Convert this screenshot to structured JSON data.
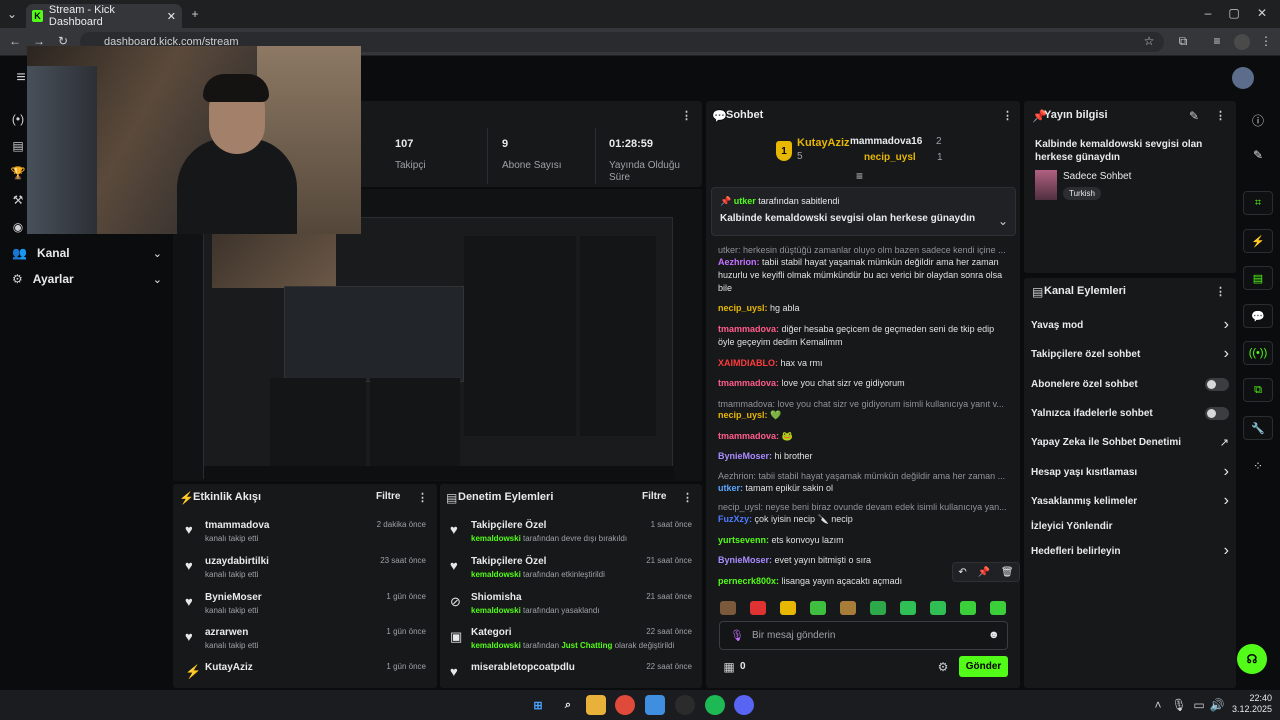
{
  "browser": {
    "tab_title": "Stream - Kick Dashboard",
    "url": "dashboard.kick.com/stream",
    "new_tab": "+"
  },
  "nav": {
    "channel": "Kanal",
    "settings": "Ayarlar"
  },
  "stats": [
    {
      "value": "107",
      "label": "Takipçi"
    },
    {
      "value": "9",
      "label": "Abone Sayısı"
    },
    {
      "value": "01:28:59",
      "label": "Yayında Olduğu Süre"
    }
  ],
  "chat": {
    "title": "Sohbet",
    "leaderboard": {
      "first": {
        "rank": "1",
        "name": "KutayAziz",
        "count": "5"
      },
      "others": [
        {
          "name": "mammadova16",
          "count": "2"
        },
        {
          "name": "necip_uysl",
          "count": "1"
        }
      ]
    },
    "pinned": {
      "by_user": "utker",
      "by_text": "tarafından sabitlendi",
      "message": "Kalbinde kemaldowski sevgisi olan herkese günaydın"
    },
    "messages": [
      {
        "reply": "utker: herkesin düştüğü zamanlar oluyo olm bazen sadece kendi içine ...",
        "user": "Aezhrion",
        "color": "#c471ff",
        "text": "tabii stabil hayat yaşamak mümkün değildir ama her zaman huzurlu ve keyifli olmak mümkündür bu acı verici bir olaydan sonra olsa bile"
      },
      {
        "user": "necip_uysl",
        "color": "#e8b700",
        "text": "hg abla"
      },
      {
        "user": "tmammadova",
        "color": "#ff5c8a",
        "text": "diğer hesaba geçicem de geçmeden seni de tkip edip öyle geçeyim dedim Kemalimm"
      },
      {
        "user": "XAIMDIABLO",
        "color": "#ff3b3b",
        "text": "hax va rmı"
      },
      {
        "user": "tmammadova",
        "color": "#ff5c8a",
        "text": "love you chat sizr ve gidiyorum"
      },
      {
        "reply": "tmammadova: love you chat sizr ve gidiyorum isimli kullanıcıya yanıt v...",
        "user": "necip_uysl",
        "color": "#e8b700",
        "text": "💚"
      },
      {
        "user": "tmammadova",
        "color": "#ff5c8a",
        "text": "🐸"
      },
      {
        "user": "BynieMoser",
        "color": "#a98cff",
        "text": "hi brother"
      },
      {
        "reply": "Aezhrion: tabii stabil hayat yaşamak mümkün değildir ama her zaman ...",
        "user": "utker",
        "color": "#5aa8ff",
        "text": "tamam epikür sakin ol"
      },
      {
        "reply": "necip_uysl: neyse beni biraz ovunde devam edek isimli kullanıcıya yan...",
        "user": "FuzXzy",
        "color": "#4d7cff",
        "text": "çok iyisin necip 🔪 necip"
      },
      {
        "user": "yurtsevenn",
        "color": "#53fc18",
        "text": "ets konvoyu lazım"
      },
      {
        "user": "BynieMoser",
        "color": "#a98cff",
        "text": "evet yayın bitmişti o sıra"
      },
      {
        "user": "pernecrk800x",
        "color": "#53fc18",
        "text": "lisanga yayın açacaktı açmadı"
      }
    ],
    "input_placeholder": "Bir mesaj gönderin",
    "points": "0",
    "send": "Gönder"
  },
  "info": {
    "title": "Yayın bilgisi",
    "stream_title": "Kalbinde kemaldowski sevgisi olan herkese günaydın",
    "category": "Sadece Sohbet",
    "language": "Turkish"
  },
  "actions": {
    "title": "Kanal Eylemleri",
    "items": [
      {
        "label": "Yavaş mod",
        "kind": "chevron"
      },
      {
        "label": "Takipçilere özel sohbet",
        "kind": "chevron"
      },
      {
        "label": "Abonelere özel sohbet",
        "kind": "toggle"
      },
      {
        "label": "Yalnızca ifadelerle sohbet",
        "kind": "toggle"
      },
      {
        "label": "Yapay Zeka ile Sohbet Denetimi",
        "kind": "external"
      },
      {
        "label": "Hesap yaşı kısıtlaması",
        "kind": "chevron"
      },
      {
        "label": "Yasaklanmış kelimeler",
        "kind": "chevron"
      },
      {
        "label": "İzleyici Yönlendir",
        "kind": "none"
      },
      {
        "label": "Hedefleri belirleyin",
        "kind": "chevron"
      }
    ]
  },
  "activity": {
    "title": "Etkinlik Akışı",
    "filter": "Filtre",
    "items": [
      {
        "user": "tmammadova",
        "sub": "kanalı takip etti",
        "time": "2 dakika önce"
      },
      {
        "user": "uzaydabirtilki",
        "sub": "kanalı takip etti",
        "time": "23 saat önce"
      },
      {
        "user": "BynieMoser",
        "sub": "kanalı takip etti",
        "time": "1 gün önce"
      },
      {
        "user": "azrarwen",
        "sub": "kanalı takip etti",
        "time": "1 gün önce"
      },
      {
        "user": "KutayAziz",
        "sub": "",
        "time": "1 gün önce"
      }
    ]
  },
  "moderation": {
    "title": "Denetim Eylemleri",
    "filter": "Filtre",
    "items": [
      {
        "title": "Takipçilere Özel",
        "mod": "kemaldowski",
        "sub": "tarafından devre dışı bırakıldı",
        "time": "1 saat önce"
      },
      {
        "title": "Takipçilere Özel",
        "mod": "kemaldowski",
        "sub": "tarafından etkinleştirildi",
        "time": "21 saat önce"
      },
      {
        "title": "Shiomisha",
        "mod": "kemaldowski",
        "sub": "tarafından yasaklandı",
        "time": "21 saat önce"
      },
      {
        "title": "Kategori",
        "mod": "kemaldowski",
        "sub": "tarafından",
        "extra": "Just Chatting",
        "sub2": "olarak değiştirildi",
        "time": "22 saat önce"
      },
      {
        "title": "miserabletopcoatpdlu",
        "mod": "",
        "sub": "",
        "time": "22 saat önce"
      }
    ]
  },
  "taskbar": {
    "time": "22:40",
    "date": "3.12.2025"
  }
}
